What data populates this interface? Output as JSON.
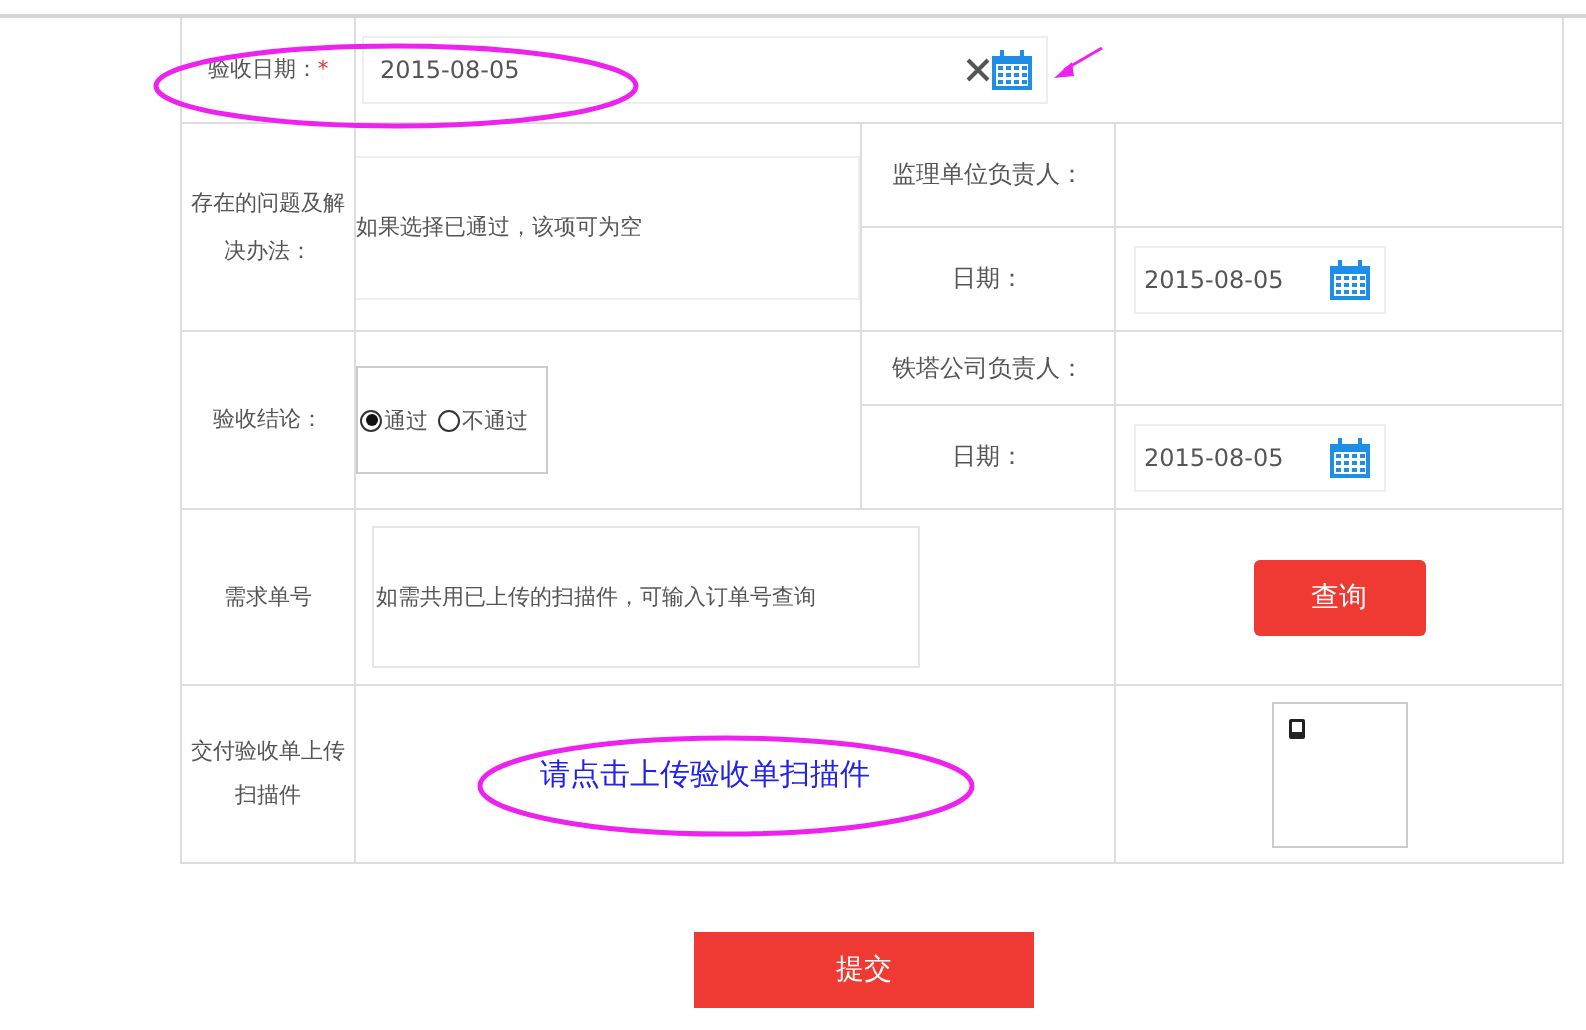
{
  "acceptance_date": {
    "label": "验收日期：",
    "required_mark": "*",
    "value": "2015-08-05"
  },
  "issues": {
    "label": "存在的问题及解决办法：",
    "placeholder": "如果选择已通过，该项可为空"
  },
  "supervisor": {
    "label": "监理单位负责人：",
    "date_label": "日期：",
    "date_value": "2015-08-05"
  },
  "conclusion": {
    "label": "验收结论：",
    "options": [
      {
        "label": "通过",
        "selected": true
      },
      {
        "label": "不通过",
        "selected": false
      }
    ]
  },
  "tower_company": {
    "label": "铁塔公司负责人：",
    "date_label": "日期：",
    "date_value": "2015-08-05"
  },
  "request_number": {
    "label": "需求单号",
    "placeholder": "如需共用已上传的扫描件，可输入订单号查询",
    "button": "查询"
  },
  "upload": {
    "label": "交付验收单上传扫描件",
    "link": "请点击上传验收单扫描件"
  },
  "submit_button": "提交"
}
